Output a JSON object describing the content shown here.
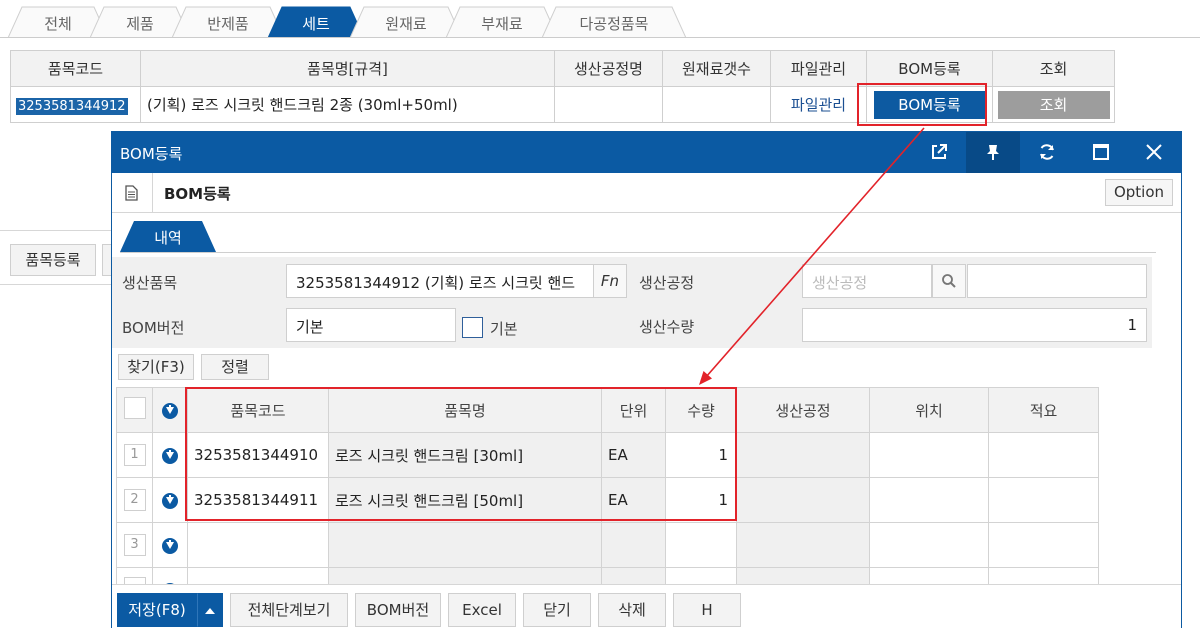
{
  "tabs": [
    {
      "label": "전체",
      "active": false
    },
    {
      "label": "제품",
      "active": false
    },
    {
      "label": "반제품",
      "active": false
    },
    {
      "label": "세트",
      "active": true
    },
    {
      "label": "원재료",
      "active": false
    },
    {
      "label": "부재료",
      "active": false
    },
    {
      "label": "다공정품목",
      "active": false
    }
  ],
  "main_table": {
    "headers": [
      "품목코드",
      "품목명[규격]",
      "생산공정명",
      "원재료갯수",
      "파일관리",
      "BOM등록",
      "조회"
    ],
    "row": {
      "code": "3253581344912",
      "name": "(기획) 로즈 시크릿 핸드크림 2종 (30ml+50ml)",
      "process": "",
      "material_count": "",
      "file_link": "파일관리",
      "bom_button": "BOM등록",
      "look_button": "조회"
    }
  },
  "side_button": "품목등록",
  "dialog": {
    "title": "BOM등록",
    "header_title": "BOM등록",
    "option_button": "Option",
    "subtab": "내역",
    "form": {
      "product_label": "생산품목",
      "product_value": "3253581344912 (기획) 로즈 시크릿 핸드",
      "fn_button": "Fn",
      "process_label": "생산공정",
      "process_placeholder": "생산공정",
      "bom_version_label": "BOM버전",
      "bom_version_value": "기본",
      "checkbox_label": "기본",
      "qty_label": "생산수량",
      "qty_value": "1"
    },
    "grid_buttons": {
      "find": "찾기(F3)",
      "sort": "정렬"
    },
    "grid": {
      "headers": [
        "품목코드",
        "품목명",
        "단위",
        "수량",
        "생산공정",
        "위치",
        "적요"
      ],
      "rows": [
        {
          "num": "1",
          "code": "3253581344910",
          "name": "로즈 시크릿 핸드크림 [30ml]",
          "unit": "EA",
          "qty": "1"
        },
        {
          "num": "2",
          "code": "3253581344911",
          "name": "로즈 시크릿 핸드크림 [50ml]",
          "unit": "EA",
          "qty": "1"
        },
        {
          "num": "3",
          "code": "",
          "name": "",
          "unit": "",
          "qty": ""
        }
      ]
    },
    "footer": {
      "save": "저장(F8)",
      "view_all": "전체단계보기",
      "bom_version": "BOM버전",
      "excel": "Excel",
      "close": "닫기",
      "delete": "삭제",
      "h": "H"
    }
  },
  "colors": {
    "primary": "#0b5aa3",
    "annotation_red": "#e2232a",
    "grey_button": "#9d9d9d"
  }
}
